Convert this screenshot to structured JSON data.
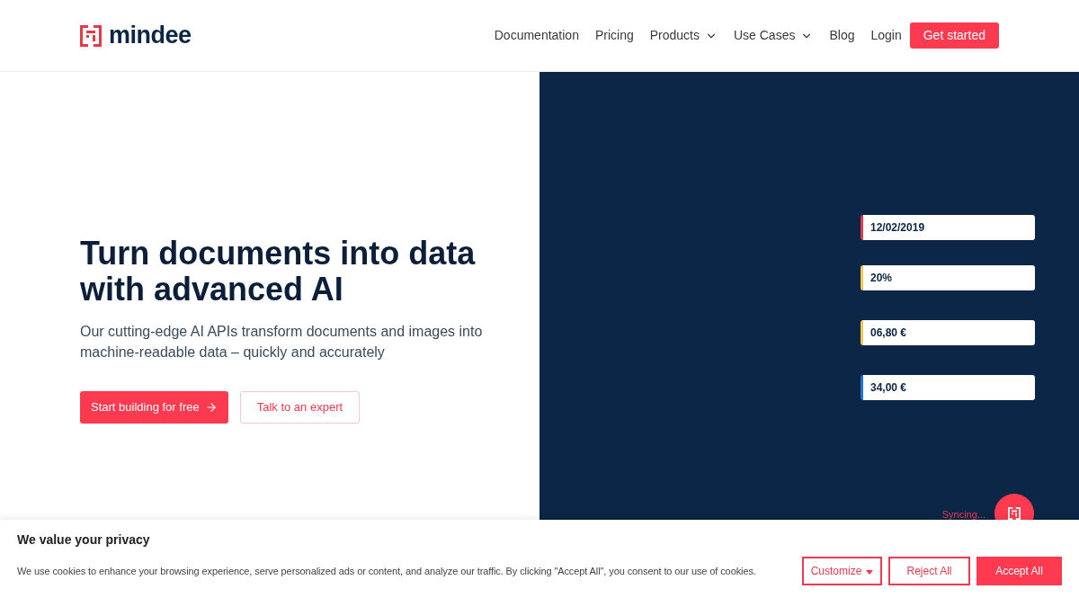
{
  "header": {
    "logo": {
      "text": "mindee"
    },
    "nav": [
      {
        "label": "Documentation",
        "kind": "link"
      },
      {
        "label": "Pricing",
        "kind": "link"
      },
      {
        "label": "Products",
        "kind": "dropdown"
      },
      {
        "label": "Use Cases",
        "kind": "dropdown"
      },
      {
        "label": "Blog",
        "kind": "link"
      },
      {
        "label": "Login",
        "kind": "link"
      }
    ],
    "cta": {
      "label": "Get started"
    }
  },
  "hero": {
    "title": "Turn documents into data with advanced AI",
    "subtitle": "Our cutting-edge AI APIs transform documents and images into machine-readable data – quickly and accurately",
    "buttons": [
      {
        "label": "Start building for free",
        "kind": "primary"
      },
      {
        "label": "Talk to an expert",
        "kind": "secondary"
      }
    ]
  },
  "demo": {
    "fields": [
      {
        "value": "12/02/2019",
        "color": "#e23a4c"
      },
      {
        "value": "20%",
        "color": "#f5c64f"
      },
      {
        "value": "06,80 €",
        "color": "#f5c64f"
      },
      {
        "value": "34,00 €",
        "color": "#1f73e0"
      }
    ],
    "status": "Syncing..."
  },
  "cookie_banner": {
    "title": "We value your privacy",
    "text": "We use cookies to enhance your browsing experience, serve personalized ads or content, and analyze our traffic. By clicking \"Accept All\", you consent to our use of cookies.",
    "buttons": [
      {
        "label": "Customize",
        "kind": "dropdown"
      },
      {
        "label": "Reject All",
        "kind": "outline"
      },
      {
        "label": "Accept All",
        "kind": "primary"
      }
    ]
  }
}
